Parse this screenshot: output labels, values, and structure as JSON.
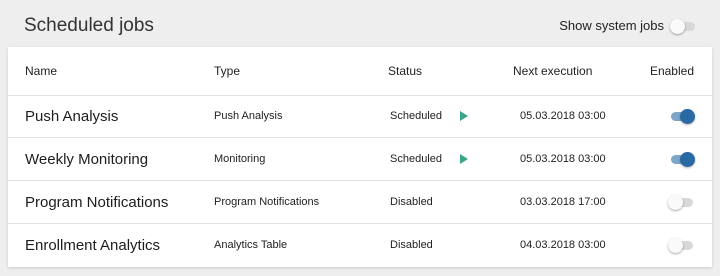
{
  "header": {
    "title": "Scheduled jobs",
    "show_system_jobs_label": "Show system jobs",
    "show_system_jobs": false
  },
  "table": {
    "columns": {
      "name": "Name",
      "type": "Type",
      "status": "Status",
      "next_execution": "Next execution",
      "enabled": "Enabled"
    },
    "rows": [
      {
        "name": "Push Analysis",
        "type": "Push Analysis",
        "status": "Scheduled",
        "next_execution": "05.03.2018 03:00",
        "enabled": true,
        "run_icon": "play-icon"
      },
      {
        "name": "Weekly Monitoring",
        "type": "Monitoring",
        "status": "Scheduled",
        "next_execution": "05.03.2018 03:00",
        "enabled": true,
        "run_icon": "play-icon"
      },
      {
        "name": "Program Notifications",
        "type": "Program Notifications",
        "status": "Disabled",
        "next_execution": "03.03.2018 17:00",
        "enabled": false
      },
      {
        "name": "Enrollment Analytics",
        "type": "Analytics Table",
        "status": "Disabled",
        "next_execution": "04.03.2018 03:00",
        "enabled": false
      }
    ]
  },
  "colors": {
    "toggle_on": "#2a6aa4",
    "toggle_on_track": "#7ea6c9",
    "play": "#3aa58a",
    "background": "#eeeeee"
  }
}
